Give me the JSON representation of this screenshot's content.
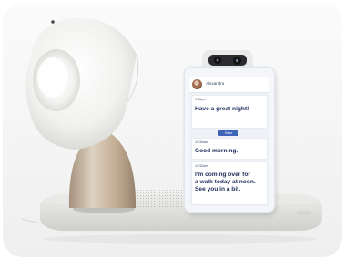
{
  "device": {
    "contact_name": "Alexandra",
    "messages": [
      {
        "time": "9:40pm",
        "text": [
          "Have a great night!"
        ]
      },
      {
        "time": "10:30am",
        "text": [
          "Good morning."
        ]
      },
      {
        "time": "10:32am",
        "text": [
          "I'm coming over for",
          "a walk today at noon.",
          "See you in a bit."
        ]
      }
    ],
    "action_label": "Share"
  },
  "colors": {
    "background": "#ffffff",
    "base": "#e4e4e2",
    "head": "#f2f2f0",
    "neck": "#c8b29a",
    "accent_button": "#3e63b8",
    "text": "#1e2d5c"
  },
  "icons": [
    "camera-icon"
  ]
}
